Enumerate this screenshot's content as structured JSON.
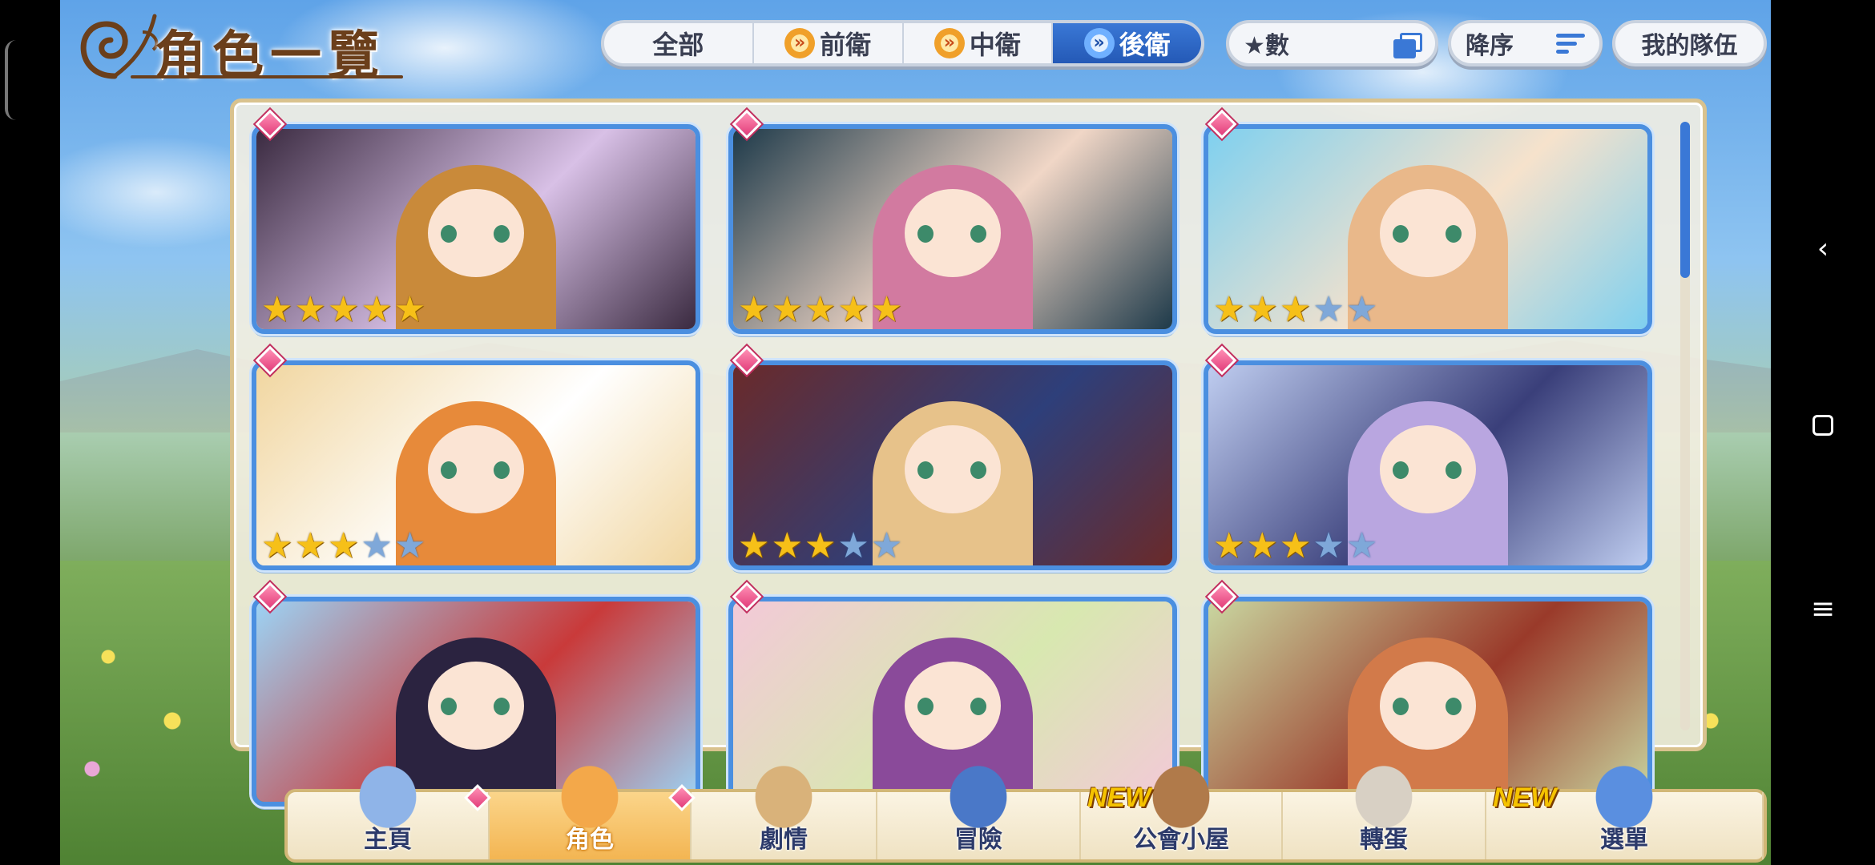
{
  "title": "角色一覽",
  "filter_tabs": [
    {
      "label": "全部",
      "active": false,
      "icon": ""
    },
    {
      "label": "前衛",
      "active": false,
      "icon": "chevron-double-icon"
    },
    {
      "label": "中衛",
      "active": false,
      "icon": "chevron-double-icon"
    },
    {
      "label": "後衛",
      "active": true,
      "icon": "chevron-double-icon"
    }
  ],
  "sort_key": {
    "label": "★數",
    "icon": "stack-icon"
  },
  "sort_order": {
    "label": "降序",
    "icon": "sort-lines-icon"
  },
  "my_team": {
    "label": "我的隊伍"
  },
  "characters": [
    {
      "stars": 5,
      "max_stars": 5,
      "art": "halloween",
      "colors": [
        "#3a2a40",
        "#c98a3a",
        "#d8c0e6"
      ]
    },
    {
      "stars": 5,
      "max_stars": 5,
      "art": "forest-night",
      "colors": [
        "#1e3a4a",
        "#d27aa0",
        "#f0d6c6"
      ]
    },
    {
      "stars": 3,
      "max_stars": 5,
      "art": "beach",
      "colors": [
        "#7fd0ef",
        "#e9b88a",
        "#f6e2cc"
      ]
    },
    {
      "stars": 3,
      "max_stars": 5,
      "art": "magic-book",
      "colors": [
        "#f1d6a0",
        "#e78a3a",
        "#ffffff"
      ]
    },
    {
      "stars": 3,
      "max_stars": 5,
      "art": "archer",
      "colors": [
        "#6a2a2a",
        "#e7c28a",
        "#2e3f7a"
      ]
    },
    {
      "stars": 3,
      "max_stars": 5,
      "art": "staff",
      "colors": [
        "#bfcdf0",
        "#b9a6e0",
        "#3a3f7a"
      ]
    },
    {
      "stars": 0,
      "max_stars": 5,
      "art": "ninja",
      "colors": [
        "#9cd3f5",
        "#2b2340",
        "#c93a3a"
      ]
    },
    {
      "stars": 0,
      "max_stars": 5,
      "art": "pink-hair",
      "colors": [
        "#f3c9d8",
        "#8a4a9a",
        "#d8e8b0"
      ]
    },
    {
      "stars": 0,
      "max_stars": 5,
      "art": "archer-field",
      "colors": [
        "#c9d6a0",
        "#d27a4a",
        "#9a3a2a"
      ]
    }
  ],
  "nav": [
    {
      "label": "主頁",
      "active": false,
      "new": false,
      "icon": "castle-icon"
    },
    {
      "label": "角色",
      "active": true,
      "new": false,
      "icon": "character-icon"
    },
    {
      "label": "劇情",
      "active": false,
      "new": false,
      "icon": "scroll-icon"
    },
    {
      "label": "冒險",
      "active": false,
      "new": false,
      "icon": "sword-flag-icon"
    },
    {
      "label": "公會小屋",
      "active": false,
      "new": true,
      "icon": "door-icon"
    },
    {
      "label": "轉蛋",
      "active": false,
      "new": false,
      "icon": "gacha-icon"
    },
    {
      "label": "選單",
      "active": false,
      "new": true,
      "icon": "crystal-icon"
    }
  ],
  "new_label": "NEW",
  "accent": "#3a78d6",
  "star_on_color": "#f6c018",
  "star_off_color": "#7fa8d9"
}
